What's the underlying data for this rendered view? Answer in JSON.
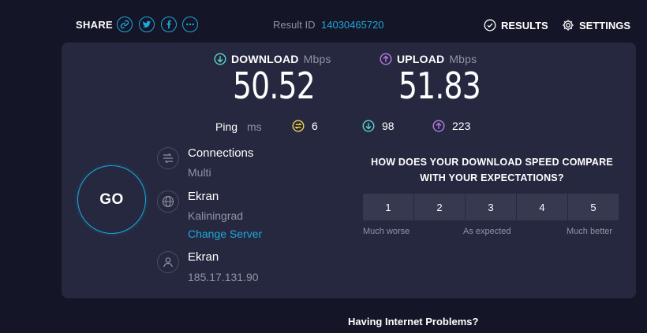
{
  "topbar": {
    "share_label": "SHARE",
    "share_icons": [
      "link-icon",
      "twitter-icon",
      "facebook-icon",
      "more-icon"
    ],
    "result_label": "Result ID",
    "result_id": "14030465720",
    "results_label": "RESULTS",
    "settings_label": "SETTINGS"
  },
  "download": {
    "label": "DOWNLOAD",
    "unit": "Mbps",
    "value": "50.52"
  },
  "upload": {
    "label": "UPLOAD",
    "unit": "Mbps",
    "value": "51.83"
  },
  "ping": {
    "label": "Ping",
    "unit": "ms",
    "idle": "6",
    "download": "98",
    "upload": "223"
  },
  "go_label": "GO",
  "connections": {
    "title": "Connections",
    "value": "Multi"
  },
  "server": {
    "name": "Ekran",
    "location": "Kaliningrad",
    "change_label": "Change Server"
  },
  "provider": {
    "name": "Ekran",
    "ip": "185.17.131.90"
  },
  "survey": {
    "question_line1": "HOW DOES YOUR DOWNLOAD SPEED COMPARE",
    "question_line2": "WITH YOUR EXPECTATIONS?",
    "options": [
      "1",
      "2",
      "3",
      "4",
      "5"
    ],
    "low_label": "Much worse",
    "mid_label": "As expected",
    "high_label": "Much better"
  },
  "footer": {
    "problems_label": "Having Internet Problems?"
  },
  "colors": {
    "background": "#141526",
    "panel": "#26283f",
    "accent_blue": "#1ca8dd",
    "download_teal": "#5ad7cf",
    "upload_purple": "#b77ce8",
    "ping_yellow": "#f3d34a",
    "muted": "#9193a8"
  }
}
